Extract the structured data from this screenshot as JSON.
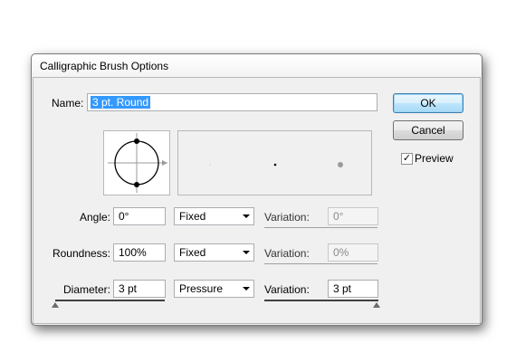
{
  "window": {
    "title": "Calligraphic Brush Options"
  },
  "name": {
    "label": "Name:",
    "value": "3 pt. Round"
  },
  "buttons": {
    "ok": "OK",
    "cancel": "Cancel"
  },
  "preview": {
    "label": "Preview",
    "checked": true,
    "check_glyph": "✓"
  },
  "rows": [
    {
      "label": "Angle:",
      "value": "0°",
      "mode": "Fixed",
      "variation_label": "Variation:",
      "variation": "0°",
      "variation_enabled": false
    },
    {
      "label": "Roundness:",
      "value": "100%",
      "mode": "Fixed",
      "variation_label": "Variation:",
      "variation": "0%",
      "variation_enabled": false
    },
    {
      "label": "Diameter:",
      "value": "3 pt",
      "mode": "Pressure",
      "variation_label": "Variation:",
      "variation": "3 pt",
      "variation_enabled": true
    }
  ],
  "colors": {
    "default_button_border": "#3c7fb1",
    "selection": "#3399ff"
  }
}
